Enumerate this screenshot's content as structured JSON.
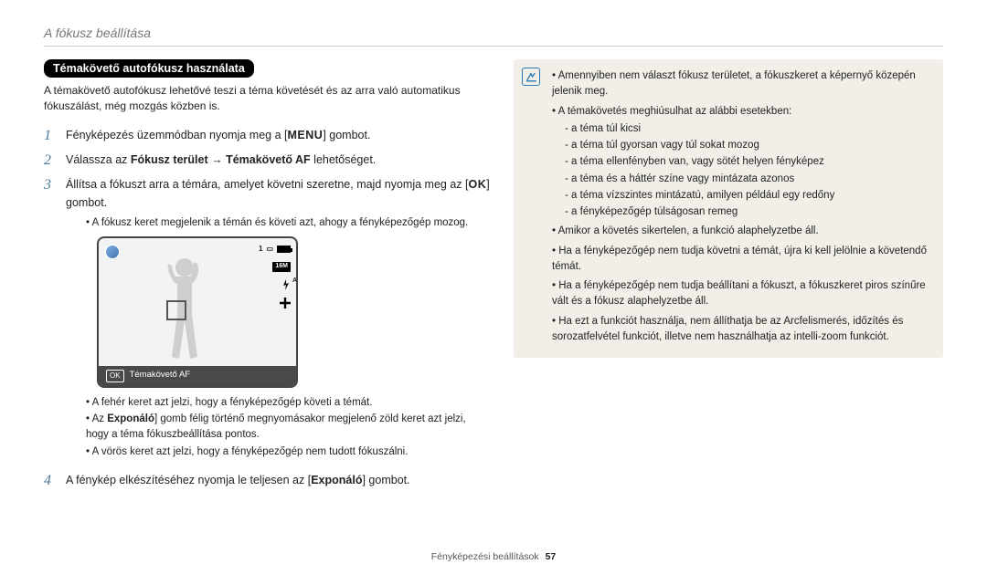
{
  "header": {
    "title": "A fókusz beállítása"
  },
  "section_chip": "Témakövető autofókusz használata",
  "intro": "A témakövető autofókusz lehetővé teszi a téma követését és az arra való automatikus fókuszálást, még mozgás közben is.",
  "steps": {
    "s1_pre": "Fényképezés üzemmódban nyomja meg a [",
    "s1_menu": "MENU",
    "s1_post": "] gombot.",
    "s2_a": "Válassza az ",
    "s2_b": "Fókusz terület",
    "s2_arrow": " → ",
    "s2_c": "Témakövető AF",
    "s2_d": " lehetőséget.",
    "s3_a": "Állítsa a fókuszt arra a témára, amelyet követni szeretne, majd nyomja meg az [",
    "s3_ok": "OK",
    "s3_b": "] gombot.",
    "s3_bullet": "A fókusz keret megjelenik a témán és követi azt, ahogy a fényképezőgép mozog.",
    "s3_bullets_after": [
      "A fehér keret azt jelzi, hogy a fényképezőgép követi a témát.",
      "Az <b>Exponáló</b>] gomb félig történő megnyomásakor megjelenő zöld keret azt jelzi, hogy a téma fókuszbeállítása pontos.",
      "A vörös keret azt jelzi, hogy a fényképezőgép nem tudott fókuszálni."
    ],
    "s4_a": "A fénykép elkészítéséhez nyomja le teljesen az [",
    "s4_b": "Exponáló",
    "s4_c": "] gombot."
  },
  "preview": {
    "ok_label": "OK",
    "mode_label": "Témakövető AF",
    "card_label": "1",
    "res_label": "16M",
    "flash_label": "A"
  },
  "note": {
    "items": [
      "Amennyiben nem választ fókusz területet, a fókuszkeret a képernyő közepén jelenik meg.",
      "A témakövetés meghiúsulhat az alábbi esetekben:"
    ],
    "dash": [
      "a téma túl kicsi",
      "a téma túl gyorsan vagy túl sokat mozog",
      "a téma ellenfényben van, vagy sötét helyen fényképez",
      "a téma és a háttér színe vagy mintázata azonos",
      "a téma vízszintes mintázatú, amilyen például egy redőny",
      "a fényképezőgép túlságosan remeg"
    ],
    "items2": [
      "Amikor a követés sikertelen, a funkció alaphelyzetbe áll.",
      "Ha a fényképezőgép nem tudja követni a témát, újra ki kell jelölnie a követendő témát.",
      "Ha a fényképezőgép nem tudja beállítani a fókuszt, a fókuszkeret piros színűre vált és a fókusz alaphelyzetbe áll.",
      "Ha ezt a funkciót használja, nem állíthatja be az Arcfelismerés, időzítés és sorozatfelvétel funkciót, illetve nem használhatja az intelli-zoom funkciót."
    ]
  },
  "footer": {
    "label": "Fényképezési beállítások",
    "page": "57"
  }
}
